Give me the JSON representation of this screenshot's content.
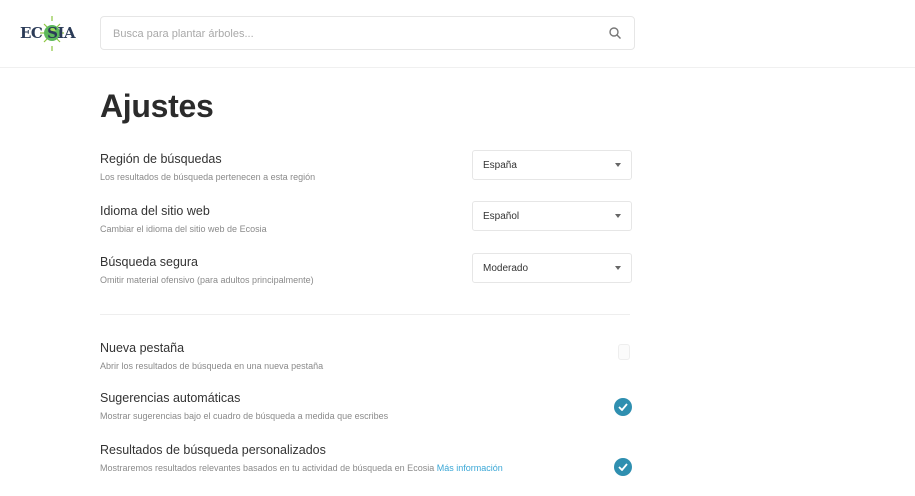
{
  "header": {
    "logo_text": "EC SIA",
    "search_placeholder": "Busca para plantar árboles..."
  },
  "page": {
    "title": "Ajustes"
  },
  "dropdown_settings": [
    {
      "label": "Región de búsquedas",
      "description": "Los resultados de búsqueda pertenecen a esta región",
      "value": "España"
    },
    {
      "label": "Idioma del sitio web",
      "description": "Cambiar el idioma del sitio web de Ecosia",
      "value": "Español"
    },
    {
      "label": "Búsqueda segura",
      "description": "Omitir material ofensivo (para adultos principalmente)",
      "value": "Moderado"
    }
  ],
  "toggle_settings": [
    {
      "label": "Nueva pestaña",
      "description": "Abrir los resultados de búsqueda en una nueva pestaña",
      "checked": false
    },
    {
      "label": "Sugerencias automáticas",
      "description": "Mostrar sugerencias bajo el cuadro de búsqueda a medida que escribes",
      "checked": true
    },
    {
      "label": "Resultados de búsqueda personalizados",
      "description": "Mostraremos resultados relevantes basados en tu actividad de búsqueda en Ecosia",
      "link_text": "Más información",
      "checked": true
    }
  ],
  "colors": {
    "accent": "#2f8fb0",
    "link": "#3aa7d6",
    "logo_green": "#5cb85c"
  }
}
